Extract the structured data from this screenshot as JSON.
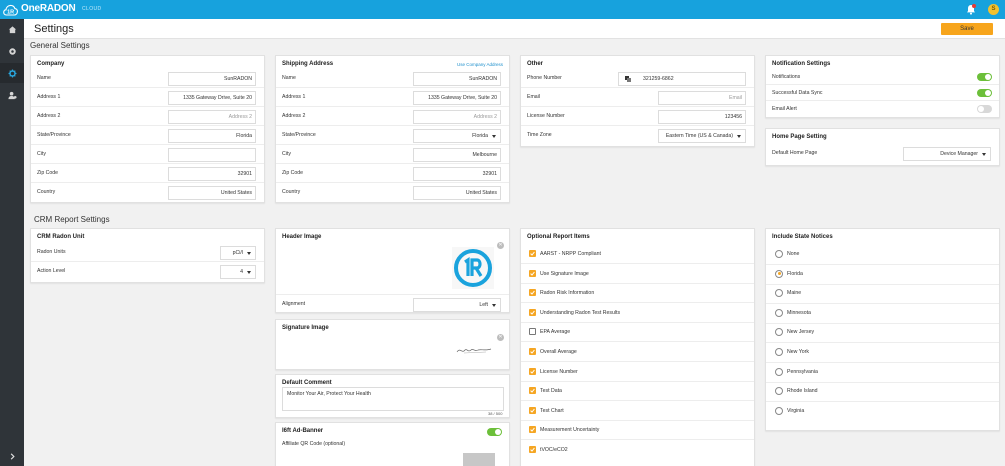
{
  "app": {
    "brand": "OneRADON",
    "cloud_tag": "CLOUD",
    "avatar_initial": "S"
  },
  "header": {
    "title": "Settings",
    "save_label": "Save"
  },
  "sections": {
    "general": "General Settings",
    "crm": "CRM Report Settings"
  },
  "company": {
    "title": "Company",
    "rows": [
      {
        "label": "Name",
        "value": "SunRADON",
        "placeholder": false
      },
      {
        "label": "Address 1",
        "value": "1335 Gateway Drive, Suite 20",
        "placeholder": false
      },
      {
        "label": "Address 2",
        "value": "Address 2",
        "placeholder": true
      },
      {
        "label": "State/Province",
        "value": "Florida",
        "placeholder": false
      },
      {
        "label": "City",
        "value": "",
        "placeholder": false
      },
      {
        "label": "Zip Code",
        "value": "32901",
        "placeholder": false
      },
      {
        "label": "Country",
        "value": "United States",
        "placeholder": false
      }
    ]
  },
  "shipping": {
    "title": "Shipping Address",
    "link": "Use Company Address",
    "rows": [
      {
        "label": "Name",
        "value": "SunRADON",
        "placeholder": false
      },
      {
        "label": "Address 1",
        "value": "1335 Gateway Drive, Suite 20",
        "placeholder": false
      },
      {
        "label": "Address 2",
        "value": "Address 2",
        "placeholder": true
      },
      {
        "label": "State/Province",
        "value": "Florida",
        "placeholder": false
      },
      {
        "label": "City",
        "value": "Melbourne",
        "placeholder": false
      },
      {
        "label": "Zip Code",
        "value": "32901",
        "placeholder": false
      },
      {
        "label": "Country",
        "value": "United States",
        "placeholder": false
      }
    ]
  },
  "other": {
    "title": "Other",
    "rows": [
      {
        "label": "Phone Number",
        "value": "321259-6862"
      },
      {
        "label": "Email",
        "value": "Email"
      },
      {
        "label": "License Number",
        "value": "123456"
      },
      {
        "label": "Time Zone",
        "value": "Eastern Time (US & Canada)"
      }
    ]
  },
  "notifications": {
    "title": "Notification Settings",
    "rows": [
      {
        "label": "Notifications",
        "on": true
      },
      {
        "label": "Successful Data Sync",
        "on": true
      },
      {
        "label": "Email Alert",
        "on": false
      }
    ]
  },
  "home_page": {
    "title": "Home Page Setting",
    "label": "Default Home Page",
    "value": "Device Manager"
  },
  "radon_unit": {
    "title": "CRM Radon Unit",
    "rows": [
      {
        "label": "Radon Units",
        "value": "pCi/l"
      },
      {
        "label": "Action Level",
        "value": "4"
      }
    ]
  },
  "header_image": {
    "title": "Header Image",
    "alignment_label": "Alignment",
    "alignment_value": "Left"
  },
  "signature_image": {
    "title": "Signature Image"
  },
  "default_comment": {
    "title": "Default Comment",
    "text": "Monitor Your Air, Protect Your Health",
    "counter": "38 / 500"
  },
  "ad_banner": {
    "title": "I6ft Ad-Banner",
    "qr_label": "Affiliate QR Code (optional)",
    "on": true
  },
  "optional_items": {
    "title": "Optional Report Items",
    "items": [
      {
        "label": "AARST - NRPP Compliant",
        "checked": true
      },
      {
        "label": "Use Signature Image",
        "checked": true
      },
      {
        "label": "Radon Risk Information",
        "checked": true
      },
      {
        "label": "Understanding Radon Test Results",
        "checked": true
      },
      {
        "label": "EPA Average",
        "checked": false
      },
      {
        "label": "Overall Average",
        "checked": true
      },
      {
        "label": "License Number",
        "checked": true
      },
      {
        "label": "Test Data",
        "checked": true
      },
      {
        "label": "Test Chart",
        "checked": true
      },
      {
        "label": "Measurement Uncertainty",
        "checked": true
      },
      {
        "label": "tVOC/eCO2",
        "checked": true
      }
    ]
  },
  "state_notices": {
    "title": "Include State Notices",
    "options": [
      {
        "label": "None",
        "selected": false
      },
      {
        "label": "Florida",
        "selected": true
      },
      {
        "label": "Maine",
        "selected": false
      },
      {
        "label": "Minnesota",
        "selected": false
      },
      {
        "label": "New Jersey",
        "selected": false
      },
      {
        "label": "New York",
        "selected": false
      },
      {
        "label": "Pennsylvania",
        "selected": false
      },
      {
        "label": "Rhode Island",
        "selected": false
      },
      {
        "label": "Virginia",
        "selected": false
      }
    ]
  },
  "colors": {
    "topbar": "#17a2dd",
    "sidebar": "#2f3439",
    "accent": "#f7a51c",
    "toggle_on": "#6cbf3a"
  }
}
